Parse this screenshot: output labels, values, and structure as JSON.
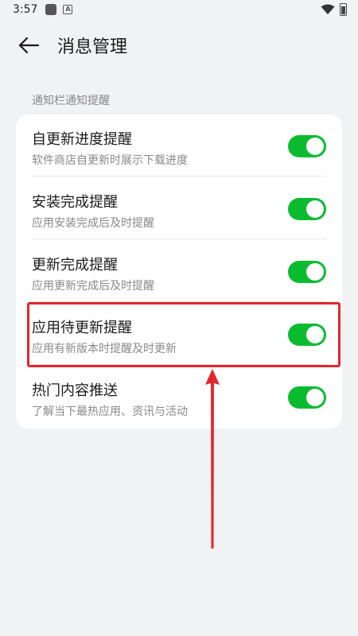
{
  "status_bar": {
    "time": "3:57",
    "a_badge": "A"
  },
  "header": {
    "back_icon": "arrow-left-icon",
    "title": "消息管理"
  },
  "section": {
    "label": "通知栏通知提醒"
  },
  "settings": [
    {
      "title": "自更新进度提醒",
      "subtitle": "软件商店自更新时展示下载进度",
      "enabled": true
    },
    {
      "title": "安装完成提醒",
      "subtitle": "应用安装完成后及时提醒",
      "enabled": true
    },
    {
      "title": "更新完成提醒",
      "subtitle": "应用更新完成后及时提醒",
      "enabled": true
    },
    {
      "title": "应用待更新提醒",
      "subtitle": "应用有新版本时提醒及时更新",
      "enabled": true
    },
    {
      "title": "热门内容推送",
      "subtitle": "了解当下最热应用、资讯与活动",
      "enabled": true
    }
  ],
  "colors": {
    "toggle_on": "#0abb30",
    "highlight": "#e3262d",
    "background": "#f1f2f4"
  }
}
